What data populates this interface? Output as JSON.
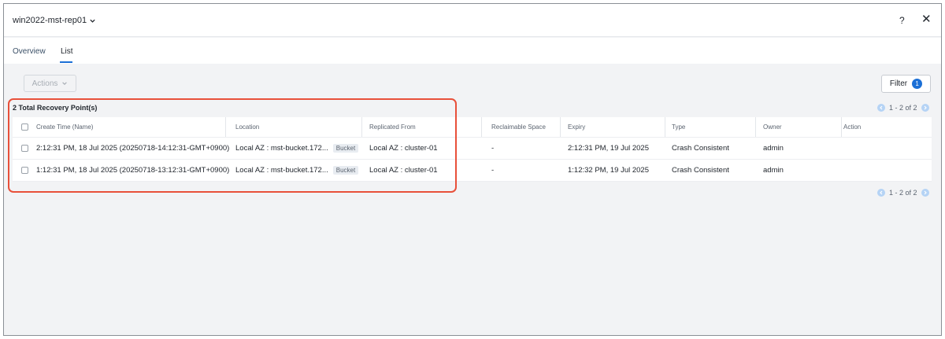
{
  "header": {
    "title": "win2022-mst-rep01",
    "help_label": "?",
    "close_label": "✕"
  },
  "tabs": [
    {
      "label": "Overview",
      "active": false
    },
    {
      "label": "List",
      "active": true
    }
  ],
  "toolbar": {
    "actions_label": "Actions",
    "filter_label": "Filter",
    "filter_count": "1"
  },
  "summary": {
    "total_label": "2 Total Recovery Point(s)",
    "pagination": "1 - 2 of 2"
  },
  "table": {
    "columns": [
      "Create Time (Name)",
      "Location",
      "Replicated From",
      "Reclaimable Space",
      "Expiry",
      "Type",
      "Owner",
      "Action"
    ],
    "rows": [
      {
        "create_time": "2:12:31 PM, 18 Jul 2025 (20250718-14:12:31-GMT+0900)",
        "location": "Local AZ : mst-bucket.172...",
        "location_tag": "Bucket",
        "replicated_from": "Local AZ : cluster-01",
        "reclaimable_space": "-",
        "expiry": "2:12:31 PM, 19 Jul 2025",
        "type": "Crash Consistent",
        "owner": "admin",
        "action": ""
      },
      {
        "create_time": "1:12:31 PM, 18 Jul 2025 (20250718-13:12:31-GMT+0900)",
        "location": "Local AZ : mst-bucket.172...",
        "location_tag": "Bucket",
        "replicated_from": "Local AZ : cluster-01",
        "reclaimable_space": "-",
        "expiry": "1:12:32 PM, 19 Jul 2025",
        "type": "Crash Consistent",
        "owner": "admin",
        "action": ""
      }
    ]
  },
  "colors": {
    "accent": "#1b6fd6",
    "highlight": "#e8503a",
    "background": "#f2f3f5"
  }
}
